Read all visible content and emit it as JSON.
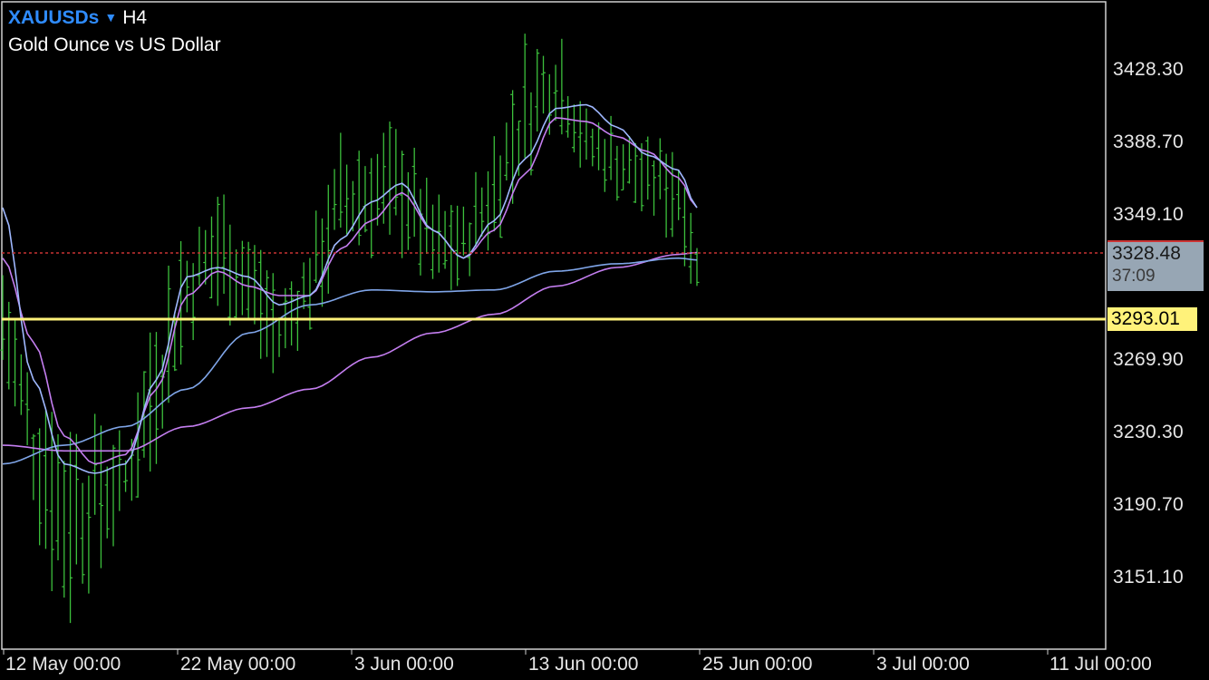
{
  "header": {
    "symbol": "XAUUSDs",
    "symbol_caret": "▼",
    "timeframe": "H4",
    "description": "Gold Ounce vs US Dollar"
  },
  "price_axis": {
    "ticks": [
      "3428.30",
      "3388.70",
      "3349.10",
      "3269.90",
      "3230.30",
      "3190.70",
      "3151.10"
    ],
    "range": [
      3116,
      3462
    ]
  },
  "time_axis": {
    "ticks": [
      "12 May 00:00",
      "22 May 00:00",
      "3 Jun 00:00",
      "13 Jun 00:00",
      "25 Jun 00:00",
      "3 Jul 00:00",
      "11 Jul 00:00"
    ]
  },
  "bid": {
    "price": "3328.48",
    "timer": "37:09",
    "color": "#97a6b4",
    "line_color": "#c83232"
  },
  "level": {
    "price": "3293.01",
    "color": "#fff27a"
  },
  "colors": {
    "bars": "#3cc03c",
    "ma_fast": "#9fb8ff",
    "ma_mid": "#c47ef0",
    "ma_slow": "#7fa5e8"
  },
  "chart_data": {
    "type": "ohlc-bar",
    "series_count": 4,
    "bars_approx": [
      {
        "t": 0,
        "h": 3325,
        "l": 3262
      },
      {
        "t": 5,
        "h": 3270,
        "l": 3180
      },
      {
        "t": 10,
        "h": 3250,
        "l": 3125
      },
      {
        "t": 15,
        "h": 3245,
        "l": 3150
      },
      {
        "t": 20,
        "h": 3230,
        "l": 3185
      },
      {
        "t": 25,
        "h": 3305,
        "l": 3215
      },
      {
        "t": 30,
        "h": 3345,
        "l": 3275
      },
      {
        "t": 35,
        "h": 3365,
        "l": 3295
      },
      {
        "t": 40,
        "h": 3345,
        "l": 3280
      },
      {
        "t": 45,
        "h": 3310,
        "l": 3258
      },
      {
        "t": 50,
        "h": 3340,
        "l": 3285
      },
      {
        "t": 55,
        "h": 3392,
        "l": 3320
      },
      {
        "t": 60,
        "h": 3395,
        "l": 3325
      },
      {
        "t": 65,
        "h": 3400,
        "l": 3325
      },
      {
        "t": 70,
        "h": 3360,
        "l": 3305
      },
      {
        "t": 75,
        "h": 3355,
        "l": 3310
      },
      {
        "t": 80,
        "h": 3395,
        "l": 3330
      },
      {
        "t": 85,
        "h": 3445,
        "l": 3360
      },
      {
        "t": 90,
        "h": 3452,
        "l": 3395
      },
      {
        "t": 95,
        "h": 3405,
        "l": 3368
      },
      {
        "t": 100,
        "h": 3400,
        "l": 3355
      },
      {
        "t": 105,
        "h": 3390,
        "l": 3345
      },
      {
        "t": 110,
        "h": 3393,
        "l": 3330
      },
      {
        "t": 113,
        "h": 3335,
        "l": 3302
      }
    ],
    "ma_fast": [
      [
        0,
        3352
      ],
      [
        5,
        3260
      ],
      [
        10,
        3215
      ],
      [
        15,
        3210
      ],
      [
        20,
        3215
      ],
      [
        25,
        3260
      ],
      [
        30,
        3315
      ],
      [
        35,
        3320
      ],
      [
        40,
        3315
      ],
      [
        45,
        3300
      ],
      [
        50,
        3305
      ],
      [
        55,
        3335
      ],
      [
        60,
        3355
      ],
      [
        65,
        3365
      ],
      [
        70,
        3340
      ],
      [
        75,
        3325
      ],
      [
        80,
        3345
      ],
      [
        85,
        3378
      ],
      [
        90,
        3405
      ],
      [
        95,
        3407
      ],
      [
        100,
        3395
      ],
      [
        105,
        3380
      ],
      [
        110,
        3372
      ],
      [
        113,
        3352
      ]
    ],
    "ma_mid": [
      [
        0,
        3325
      ],
      [
        5,
        3280
      ],
      [
        10,
        3230
      ],
      [
        15,
        3215
      ],
      [
        20,
        3220
      ],
      [
        25,
        3255
      ],
      [
        30,
        3305
      ],
      [
        35,
        3318
      ],
      [
        40,
        3310
      ],
      [
        45,
        3305
      ],
      [
        50,
        3305
      ],
      [
        55,
        3330
      ],
      [
        60,
        3345
      ],
      [
        65,
        3360
      ],
      [
        70,
        3340
      ],
      [
        75,
        3325
      ],
      [
        80,
        3340
      ],
      [
        85,
        3370
      ],
      [
        90,
        3400
      ],
      [
        95,
        3398
      ],
      [
        100,
        3390
      ],
      [
        105,
        3382
      ],
      [
        110,
        3368
      ],
      [
        113,
        3352
      ]
    ],
    "ma_slow": [
      [
        0,
        3215
      ],
      [
        10,
        3225
      ],
      [
        20,
        3235
      ],
      [
        30,
        3255
      ],
      [
        40,
        3285
      ],
      [
        50,
        3300
      ],
      [
        60,
        3308
      ],
      [
        70,
        3307
      ],
      [
        80,
        3308
      ],
      [
        90,
        3318
      ],
      [
        100,
        3322
      ],
      [
        110,
        3325
      ],
      [
        113,
        3324
      ]
    ],
    "ma_long": [
      [
        0,
        3225
      ],
      [
        10,
        3222
      ],
      [
        20,
        3222
      ],
      [
        30,
        3235
      ],
      [
        40,
        3245
      ],
      [
        50,
        3255
      ],
      [
        60,
        3272
      ],
      [
        70,
        3285
      ],
      [
        80,
        3295
      ],
      [
        90,
        3310
      ],
      [
        100,
        3320
      ],
      [
        110,
        3327
      ],
      [
        113,
        3328
      ]
    ]
  }
}
